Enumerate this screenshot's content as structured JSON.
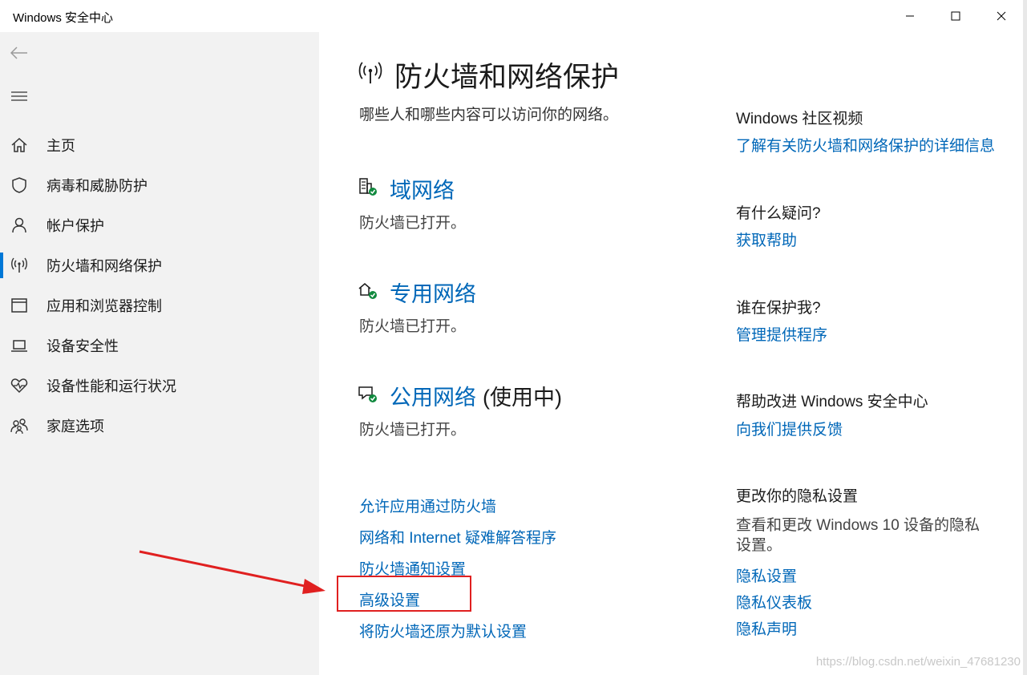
{
  "window": {
    "title": "Windows 安全中心"
  },
  "sidebar": {
    "items": [
      {
        "label": "主页",
        "icon": "home-icon"
      },
      {
        "label": "病毒和威胁防护",
        "icon": "shield-icon"
      },
      {
        "label": "帐户保护",
        "icon": "person-icon"
      },
      {
        "label": "防火墙和网络保护",
        "icon": "antenna-icon",
        "active": true
      },
      {
        "label": "应用和浏览器控制",
        "icon": "browser-window-icon"
      },
      {
        "label": "设备安全性",
        "icon": "laptop-icon"
      },
      {
        "label": "设备性能和运行状况",
        "icon": "heart-pulse-icon"
      },
      {
        "label": "家庭选项",
        "icon": "family-icon"
      }
    ]
  },
  "main": {
    "title": "防火墙和网络保护",
    "subtitle": "哪些人和哪些内容可以访问你的网络。",
    "networks": [
      {
        "name": "域网络",
        "suffix": "",
        "status": "防火墙已打开。",
        "icon": "domain-network-icon"
      },
      {
        "name": "专用网络",
        "suffix": "",
        "status": "防火墙已打开。",
        "icon": "private-network-icon"
      },
      {
        "name": "公用网络",
        "suffix": "(使用中)",
        "status": "防火墙已打开。",
        "icon": "public-network-icon"
      }
    ],
    "links": [
      "允许应用通过防火墙",
      "网络和 Internet 疑难解答程序",
      "防火墙通知设置",
      "高级设置",
      "将防火墙还原为默认设置"
    ]
  },
  "right": {
    "community": {
      "title": "Windows 社区视频",
      "link": "了解有关防火墙和网络保护的详细信息"
    },
    "question": {
      "title": "有什么疑问?",
      "link": "获取帮助"
    },
    "protector": {
      "title": "谁在保护我?",
      "link": "管理提供程序"
    },
    "improve": {
      "title": "帮助改进 Windows 安全中心",
      "link": "向我们提供反馈"
    },
    "privacy": {
      "title": "更改你的隐私设置",
      "text": "查看和更改 Windows 10 设备的隐私设置。",
      "links": [
        "隐私设置",
        "隐私仪表板",
        "隐私声明"
      ]
    }
  },
  "watermark": "https://blog.csdn.net/weixin_47681230",
  "colors": {
    "accent": "#0078d7",
    "link": "#0067b8",
    "sidebar_bg": "#f2f2f2",
    "annotation": "#e02020"
  }
}
